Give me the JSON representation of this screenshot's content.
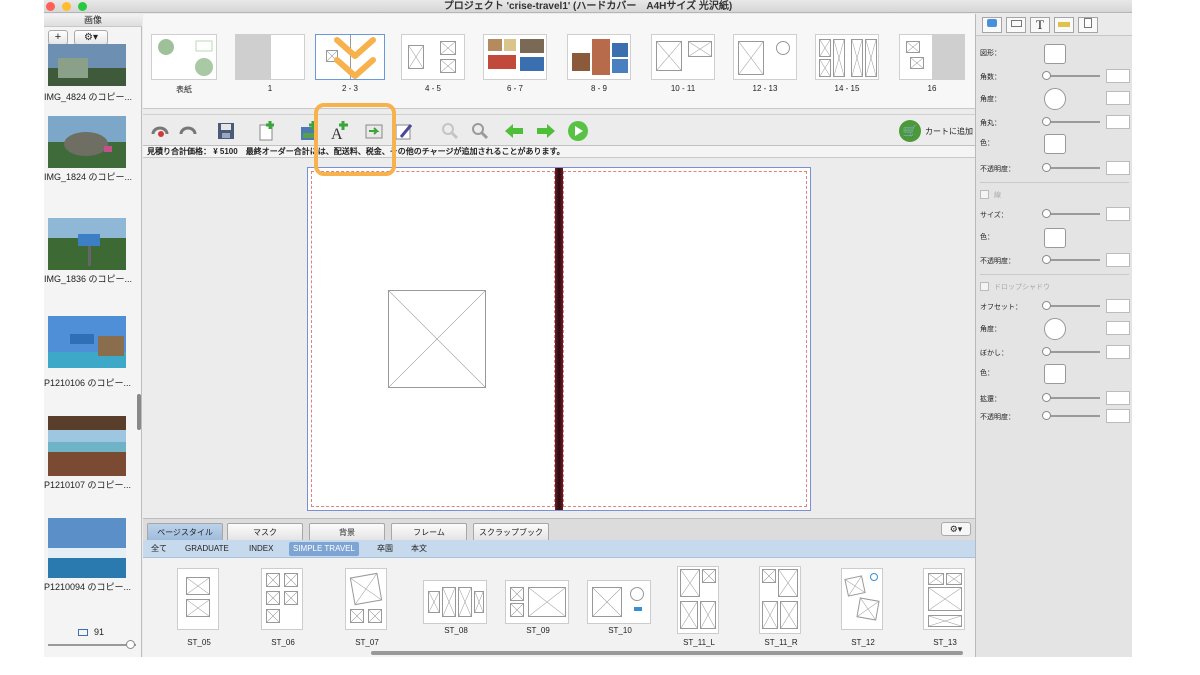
{
  "window": {
    "title": "プロジェクト 'crise-travel1' (ハードカバー　A4Hサイズ 光沢紙)"
  },
  "left_panel": {
    "header": "画像",
    "add_label": "+",
    "gear_label": "⚙▾",
    "photos": [
      {
        "caption": "IMG_4824 のコピー..."
      },
      {
        "caption": "IMG_1824 のコピー..."
      },
      {
        "caption": "IMG_1836 のコピー..."
      },
      {
        "caption": "P1210106 のコピー..."
      },
      {
        "caption": "P1210107 のコピー..."
      },
      {
        "caption": "P1210094 のコピー..."
      }
    ],
    "count": "91"
  },
  "page_strip": {
    "pages": [
      {
        "label": "表紙"
      },
      {
        "label": "1"
      },
      {
        "label": "2 - 3"
      },
      {
        "label": "4 - 5"
      },
      {
        "label": "6 - 7"
      },
      {
        "label": "8 - 9"
      },
      {
        "label": "10 - 11"
      },
      {
        "label": "12 - 13"
      },
      {
        "label": "14 - 15"
      },
      {
        "label": "16"
      }
    ]
  },
  "toolbar": {
    "icons": [
      "undo-icon",
      "redo-icon",
      "save-icon",
      "add-page-icon",
      "add-photo-frame-icon",
      "add-text-icon",
      "export-icon",
      "edit-icon",
      "zoom-out-icon",
      "zoom-in-icon",
      "arrow-left-icon",
      "arrow-right-icon",
      "play-icon"
    ],
    "cart_label": "カートに追加"
  },
  "info": {
    "text": "見積り合計価格： ¥ 5100　最終オーダー合計には、配送料、税金、その他のチャージが追加されることがあります。"
  },
  "bottom_tabs": [
    {
      "label": "ページスタイル"
    },
    {
      "label": "マスク"
    },
    {
      "label": "背景"
    },
    {
      "label": "フレーム"
    },
    {
      "label": "スクラップブック"
    }
  ],
  "style_gear_label": "⚙▾",
  "filters": [
    {
      "label": "全て"
    },
    {
      "label": "GRADUATE"
    },
    {
      "label": "INDEX"
    },
    {
      "label": "SIMPLE TRAVEL"
    },
    {
      "label": "卒園"
    },
    {
      "label": "本文"
    }
  ],
  "styles": [
    {
      "label": "ST_05"
    },
    {
      "label": "ST_06"
    },
    {
      "label": "ST_07"
    },
    {
      "label": "ST_08"
    },
    {
      "label": "ST_09"
    },
    {
      "label": "ST_10"
    },
    {
      "label": "ST_11_L"
    },
    {
      "label": "ST_11_R"
    },
    {
      "label": "ST_12"
    },
    {
      "label": "ST_13"
    }
  ],
  "inspector": {
    "tabs": [
      "shape-tab-icon",
      "frame-tab-icon",
      "T",
      "ruler-tab-icon",
      "page-tab-icon"
    ],
    "rows": [
      {
        "label": "図形："
      },
      {
        "label": "角数："
      },
      {
        "label": "角度："
      },
      {
        "label": "角丸："
      },
      {
        "label": "色："
      },
      {
        "label": "不透明度："
      },
      {
        "label": "線"
      },
      {
        "label": "サイズ："
      },
      {
        "label": "色："
      },
      {
        "label": "不透明度："
      },
      {
        "label": "ドロップシャドウ"
      },
      {
        "label": "オフセット："
      },
      {
        "label": "角度："
      },
      {
        "label": "ぼかし："
      },
      {
        "label": "色："
      },
      {
        "label": "拡還："
      },
      {
        "label": "不透明度："
      }
    ]
  },
  "colors": {
    "accent": "#f7b14d",
    "selected_tab": "#7ea4d3"
  }
}
